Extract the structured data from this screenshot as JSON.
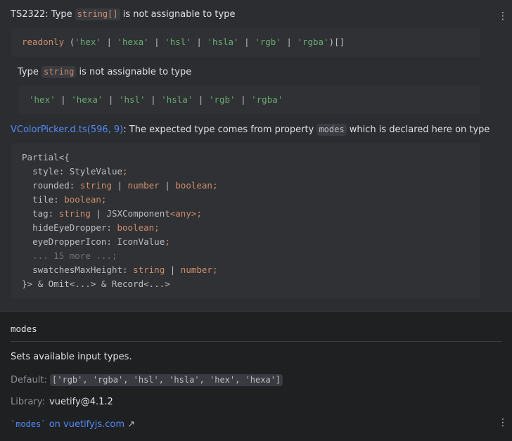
{
  "error": {
    "code_prefix": "TS2322: Type",
    "type_chip": "string[]",
    "suffix": "is not assignable to type",
    "box1": {
      "keyword": "readonly",
      "open": "(",
      "values": [
        "'hex'",
        "'hexa'",
        "'hsl'",
        "'hsla'",
        "'rgb'",
        "'rgba'"
      ],
      "close": ")[]"
    },
    "sub_prefix": "Type",
    "sub_chip": "string",
    "sub_suffix": "is not assignable to type",
    "box2_values": [
      "'hex'",
      "'hexa'",
      "'hsl'",
      "'hsla'",
      "'rgb'",
      "'rgba'"
    ],
    "source_link": "VColorPicker.d.ts(596, 9)",
    "source_mid": ": The expected type comes from property",
    "source_chip": "modes",
    "source_suffix": "which is declared here on type"
  },
  "declaration": {
    "open": "Partial<{",
    "lines": [
      {
        "name": "style",
        "type": "StyleValue"
      },
      {
        "name": "rounded",
        "type": "string | number | boolean"
      },
      {
        "name": "tile",
        "type": "boolean"
      },
      {
        "name": "tag",
        "type": "string | JSXComponent<any>"
      },
      {
        "name": "hideEyeDropper",
        "type": "boolean"
      },
      {
        "name": "eyeDropperIcon",
        "type": "IconValue"
      },
      {
        "name": "",
        "type": "... 15 more ..."
      },
      {
        "name": "swatchesMaxHeight",
        "type": "string | number"
      }
    ],
    "close": "}> & Omit<...> & Record<...>"
  },
  "doc": {
    "prop_name": "modes",
    "description": "Sets available input types.",
    "default_label": "Default:",
    "default_value": "['rgb', 'rgba', 'hsl', 'hsla', 'hex', 'hexa']",
    "library_label": "Library:",
    "library_value": "vuetify@4.1.2",
    "link_code": "`modes`",
    "link_text": "on vuetifyjs.com",
    "link_arrow": "↗"
  },
  "icons": {
    "more_top": "more-vertical-icon",
    "more_bottom": "more-vertical-icon"
  },
  "colors": {
    "background": "#2b2d30",
    "doc_background": "#1f2022",
    "keyword": "#cf8e6d",
    "string": "#6aab73",
    "link": "#548af7"
  }
}
